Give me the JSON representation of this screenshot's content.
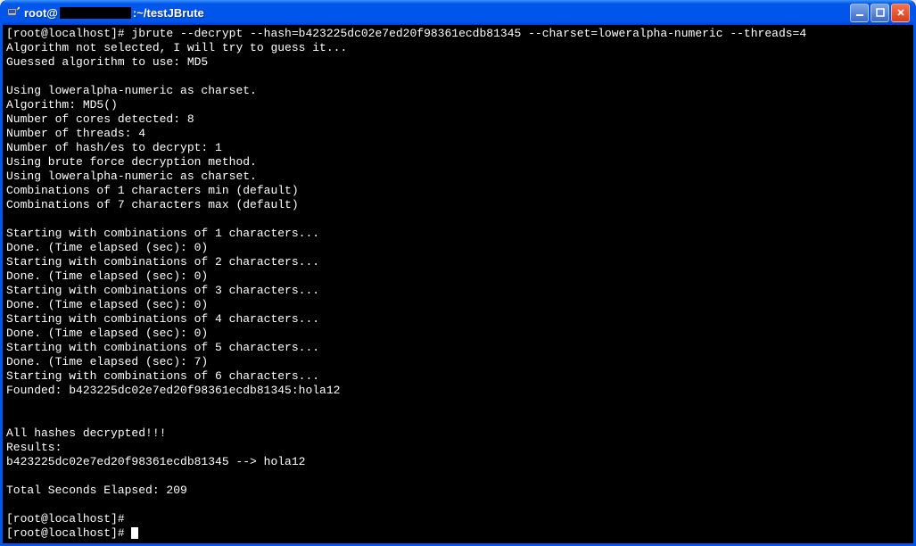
{
  "titlebar": {
    "user": "root@",
    "path": ":~/testJBrute"
  },
  "window_controls": {
    "minimize": "_",
    "maximize": "□",
    "close": "X"
  },
  "terminal": {
    "prompt": "[root@localhost]#",
    "command": "jbrute --decrypt --hash=b423225dc02e7ed20f98361ecdb81345 --charset=loweralpha-numeric --threads=4",
    "lines": [
      "Algorithm not selected, I will try to guess it...",
      "Guessed algorithm to use: MD5",
      "",
      "Using loweralpha-numeric as charset.",
      "Algorithm: MD5()",
      "Number of cores detected: 8",
      "Number of threads: 4",
      "Number of hash/es to decrypt: 1",
      "Using brute force decryption method.",
      "Using loweralpha-numeric as charset.",
      "Combinations of 1 characters min (default)",
      "Combinations of 7 characters max (default)",
      "",
      "Starting with combinations of 1 characters...",
      "Done. (Time elapsed (sec): 0)",
      "Starting with combinations of 2 characters...",
      "Done. (Time elapsed (sec): 0)",
      "Starting with combinations of 3 characters...",
      "Done. (Time elapsed (sec): 0)",
      "Starting with combinations of 4 characters...",
      "Done. (Time elapsed (sec): 0)",
      "Starting with combinations of 5 characters...",
      "Done. (Time elapsed (sec): 7)",
      "Starting with combinations of 6 characters...",
      "Founded: b423225dc02e7ed20f98361ecdb81345:hola12",
      "",
      "",
      "All hashes decrypted!!!",
      "Results:",
      "b423225dc02e7ed20f98361ecdb81345 --> hola12",
      "",
      "Total Seconds Elapsed: 209",
      ""
    ],
    "trailing_prompts": [
      "[root@localhost]#",
      "[root@localhost]#"
    ]
  }
}
